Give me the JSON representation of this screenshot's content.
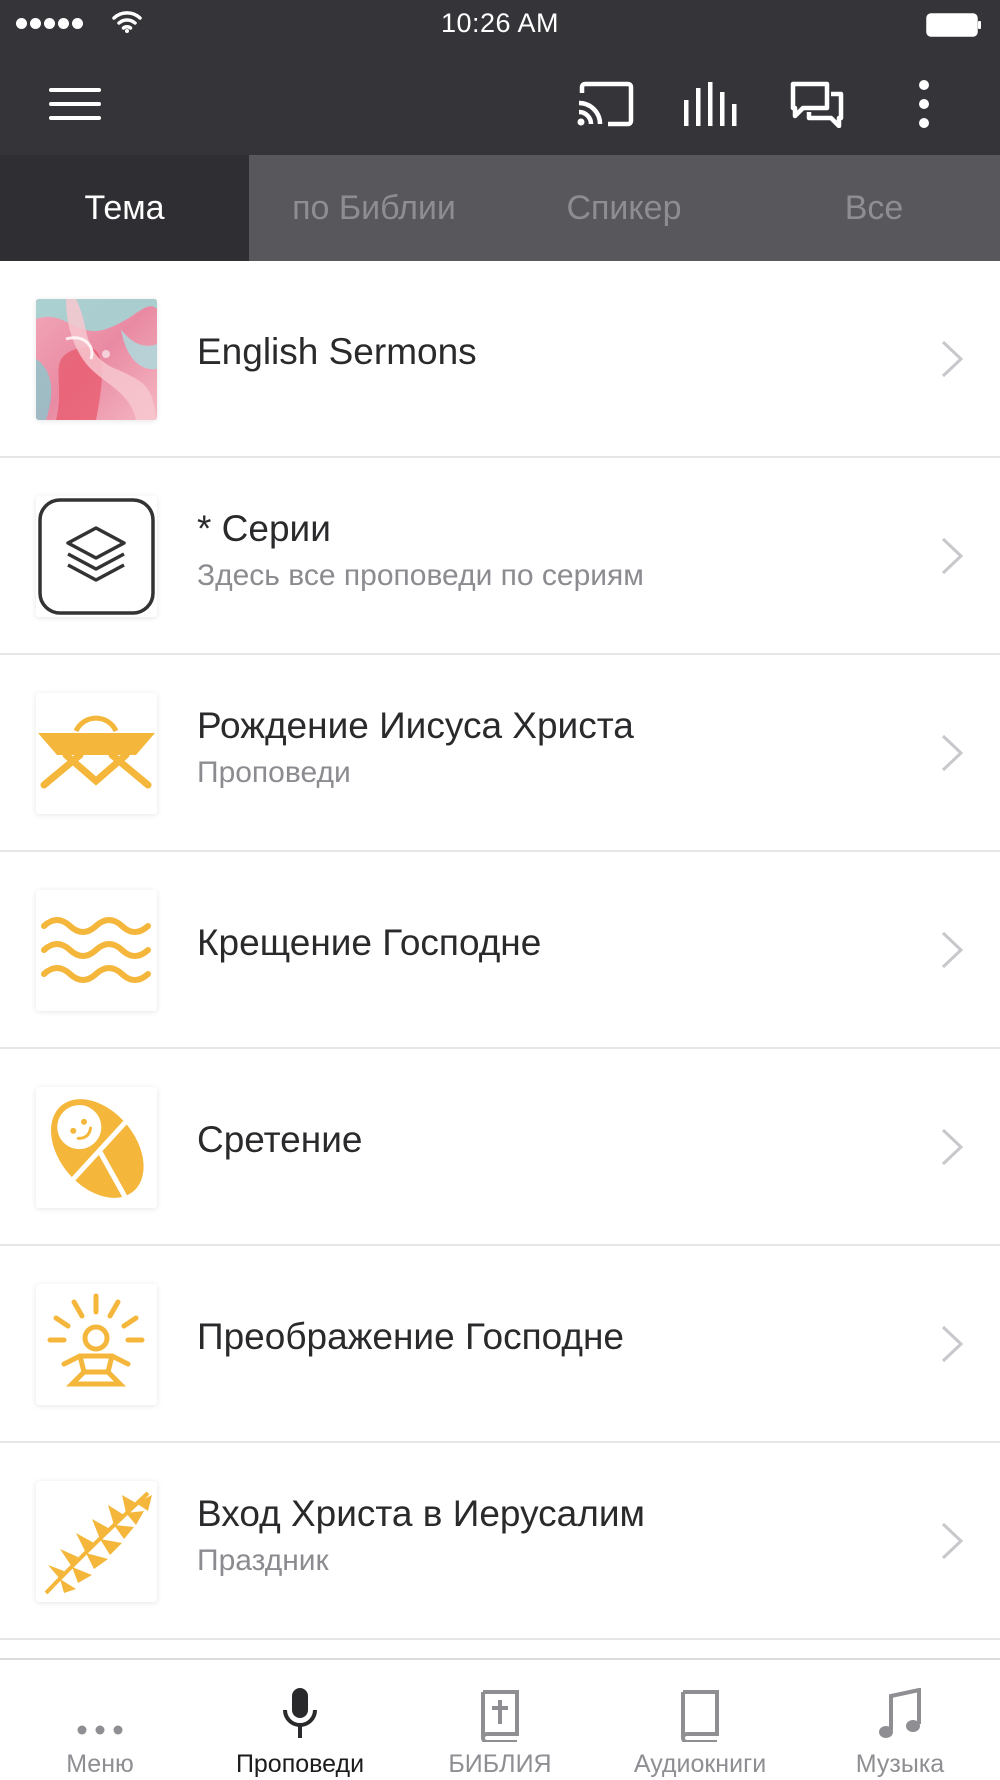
{
  "status_bar": {
    "time": "10:26 AM"
  },
  "nav_tabs": [
    {
      "label": "Тема",
      "active": true
    },
    {
      "label": "по Библии",
      "active": false
    },
    {
      "label": "Спикер",
      "active": false
    },
    {
      "label": "Все",
      "active": false
    }
  ],
  "list": [
    {
      "title": "English Sermons",
      "subtitle": "",
      "icon": "marble-art-image"
    },
    {
      "title": "* Серии",
      "subtitle": "Здесь все проповеди по сериям",
      "icon": "layers-icon"
    },
    {
      "title": "Рождение Иисуса Христа",
      "subtitle": "Проповеди",
      "icon": "manger-icon"
    },
    {
      "title": "Крещение Господне",
      "subtitle": "",
      "icon": "waves-icon"
    },
    {
      "title": "Сретение",
      "subtitle": "",
      "icon": "swaddled-baby-icon"
    },
    {
      "title": "Преображение Господне",
      "subtitle": "",
      "icon": "radiant-figure-icon"
    },
    {
      "title": "Вход Христа в Иерусалим",
      "subtitle": "Праздник",
      "icon": "palm-branch-icon"
    }
  ],
  "tab_bar": [
    {
      "label": "Меню",
      "icon": "more-dots-icon",
      "active": false
    },
    {
      "label": "Проповеди",
      "icon": "microphone-icon",
      "active": true
    },
    {
      "label": "БИБЛИЯ",
      "icon": "bible-icon",
      "active": false
    },
    {
      "label": "Аудиокниги",
      "icon": "book-icon",
      "active": false
    },
    {
      "label": "Музыка",
      "icon": "music-note-icon",
      "active": false
    }
  ],
  "colors": {
    "header_bg": "#353439",
    "tabs_bg": "#58575c",
    "active_tab_bg": "#2f2e33",
    "accent_yellow": "#f4b73b"
  }
}
